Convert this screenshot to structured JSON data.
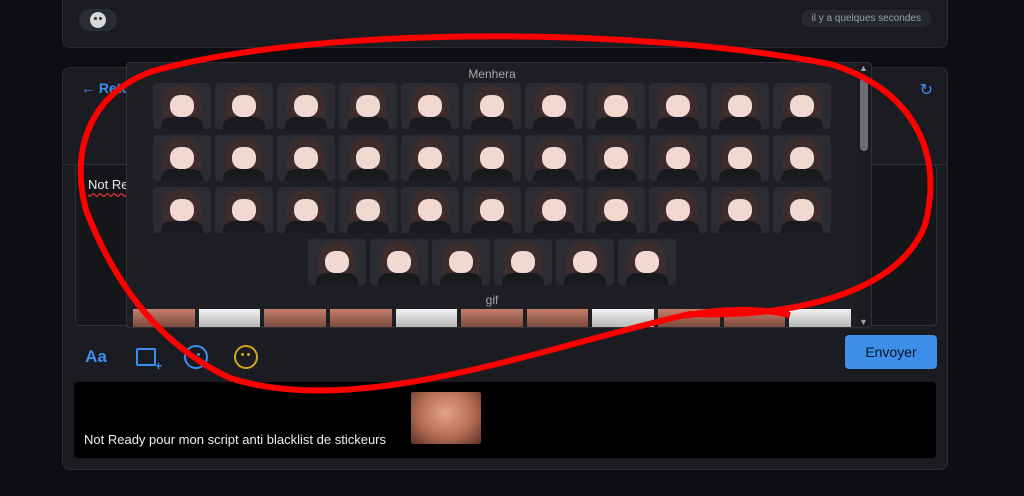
{
  "top": {
    "timestamp": "il y a quelques secondes"
  },
  "composer": {
    "back_label": "← Reto",
    "editor_text": "Not Re",
    "send_label": "Envoyer",
    "tools": [
      "text-format-icon",
      "add-image-icon",
      "emoji-icon",
      "sticker-icon"
    ],
    "tool_text_label": "Aa"
  },
  "picker": {
    "section_stickers": "Menhera",
    "section_gifs": "gif"
  },
  "preview": {
    "text": "Not Ready pour mon script anti blacklist de stickeurs"
  },
  "colors": {
    "accent": "#3b8ff0",
    "send": "#3d8ee8",
    "annotation": "#ff0000"
  }
}
